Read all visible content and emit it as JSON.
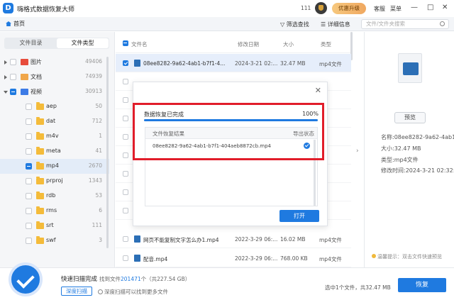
{
  "app": {
    "title": "嗨格式数据恢复大师",
    "logo_letter": "D",
    "user_count": "111",
    "upgrade_label": "优惠升级",
    "service_label": "客服",
    "menu_label": "菜单",
    "minimize": "—",
    "maximize": "□",
    "close": "✕"
  },
  "toolbar": {
    "home_label": "首页",
    "filter_label": "筛选查找",
    "detail_label": "详细信息",
    "search_placeholder": "文件/文件夹搜索"
  },
  "sidebar": {
    "tabs": [
      {
        "label": "文件目录",
        "active": false
      },
      {
        "label": "文件类型",
        "active": true
      }
    ],
    "items": [
      {
        "label": "图片",
        "count": "49406",
        "level": 0,
        "icon": "image-icon"
      },
      {
        "label": "文档",
        "count": "74939",
        "level": 0,
        "icon": "document-icon"
      },
      {
        "label": "视频",
        "count": "30913",
        "level": 0,
        "icon": "video-icon",
        "expanded": true
      },
      {
        "label": "aep",
        "count": "50",
        "level": 1
      },
      {
        "label": "dat",
        "count": "712",
        "level": 1
      },
      {
        "label": "m4v",
        "count": "1",
        "level": 1
      },
      {
        "label": "meta",
        "count": "41",
        "level": 1
      },
      {
        "label": "mp4",
        "count": "2670",
        "level": 1,
        "selected": true
      },
      {
        "label": "prproj",
        "count": "1343",
        "level": 1
      },
      {
        "label": "rdb",
        "count": "53",
        "level": 1
      },
      {
        "label": "rms",
        "count": "6",
        "level": 1
      },
      {
        "label": "srt",
        "count": "111",
        "level": 1
      },
      {
        "label": "swf",
        "count": "3",
        "level": 1
      }
    ]
  },
  "file_list": {
    "columns": {
      "name": "文件名",
      "modified": "修改日期",
      "size": "大小",
      "type": "类型"
    },
    "rows": [
      {
        "name": "08ee8282-9a62-4ab1-b7f1-4...",
        "modified": "2024-3-21 02:...",
        "size": "32.47 MB",
        "type": "mp4文件",
        "checked": true,
        "selected": true
      },
      {
        "name": "网页不能复制文字怎么办1.mp4",
        "modified": "2022-3-29 06:...",
        "size": "16.02 MB",
        "type": "mp4文件",
        "checked": false
      },
      {
        "name": "配音.mp4",
        "modified": "2022-3-29 06:...",
        "size": "768.00 KB",
        "type": "mp4文件",
        "checked": false
      }
    ]
  },
  "right_panel": {
    "preview_label": "预览",
    "name_line": "名称:08ee8282-9a62-4ab1...",
    "size_line": "大小:32.47 MB",
    "type_line": "类型:mp4文件",
    "modified_line": "修改时间:2024-3-21 02:32:...",
    "tip": "温馨提示：双击文件快速预览"
  },
  "dialog": {
    "title": "数据恢复已完成",
    "percent_text": "100%",
    "progress": 1.0,
    "col_result": "文件恢复结果",
    "col_status": "导出状态",
    "result_file": "08ee8282-9a62-4ab1-b7f1-404aeb8872cb.mp4",
    "open_label": "打开",
    "close_glyph": "✕"
  },
  "bottom": {
    "scan_title": "快速扫描完成",
    "found_prefix": "找到文件",
    "found_count": "201471",
    "found_suffix": "个（共227.54 GB）",
    "deep_label": "深度扫描",
    "deep_hint": "深度扫描可以找到更多文件",
    "selection": "选中1个文件，共32.47 MB",
    "recover_label": "恢复"
  },
  "colors": {
    "accent": "#1f7ae0",
    "highlight": "#e11d2a",
    "upgrade": "#f0a860"
  }
}
